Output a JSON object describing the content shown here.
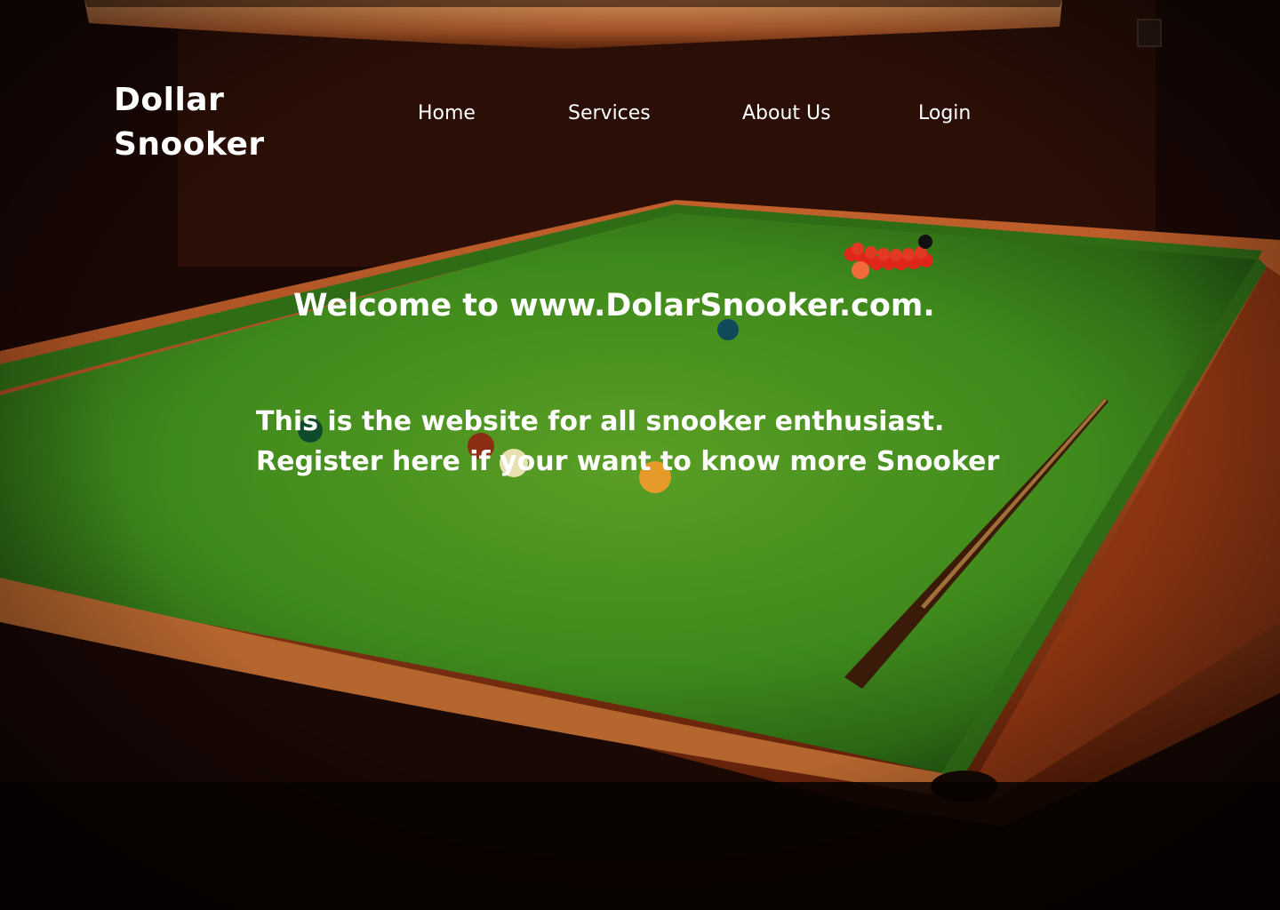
{
  "brand": {
    "title": "Dollar Snooker"
  },
  "nav": {
    "items": [
      {
        "label": "Home"
      },
      {
        "label": "Services"
      },
      {
        "label": "About Us"
      },
      {
        "label": "Login"
      }
    ]
  },
  "hero": {
    "welcome": "Welcome to www.DolarSnooker.com.",
    "line1": "This is the website for all snooker enthusiast.",
    "line2": "Register here if your want to know more Snooker"
  },
  "colors": {
    "text": "#ffffff",
    "felt": "#3f8a1f",
    "cushion": "#8a2f0c",
    "room": "#0a0403"
  }
}
